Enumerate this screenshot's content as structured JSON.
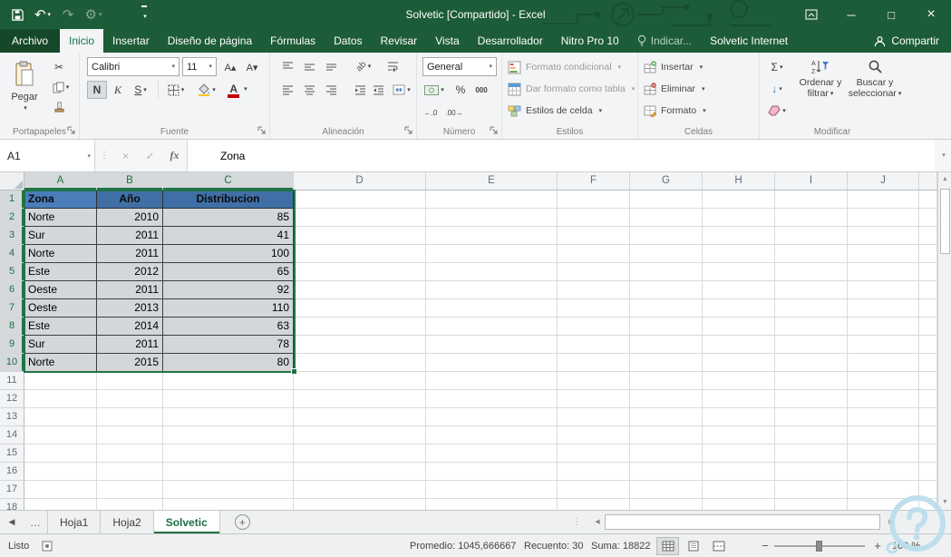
{
  "colors": {
    "accent": "#217346",
    "title_bar": "#1d5c38",
    "header_fill": "#3f6fa5",
    "active_header_fill": "#4a7dba",
    "selection_fill": "#d3d7da"
  },
  "title_bar": {
    "title": "Solvetic  [Compartido] - Excel"
  },
  "icons": {
    "undo": "↶",
    "redo": "↷",
    "gear": "⚙",
    "minimize": "─",
    "maximize": "□",
    "close": "×",
    "cut": "✂",
    "font_grow": "A▴",
    "font_shrink": "A▾",
    "bold": "N",
    "italic": "K",
    "underline": "S",
    "font_color_letter": "A",
    "fill_color_letter": "",
    "orientation": "ab",
    "percent": "%",
    "thousands": "000",
    "decimal_inc": "←.0",
    "decimal_dec": ".00→",
    "sigma": "Σ",
    "fill_down": "↓",
    "cancel": "×",
    "check": "✓",
    "fx": "fx",
    "dots": "⋮",
    "scroll_up": "▲",
    "scroll_down": "▼",
    "scroll_left": "◀",
    "scroll_right": "▶",
    "tab_nav_left": "◀",
    "tab_ellipsis": "…",
    "new_sheet": "+",
    "zoom_out": "−",
    "zoom_in": "+"
  },
  "ribbon_tabs": {
    "items": [
      {
        "label": "Archivo"
      },
      {
        "label": "Inicio",
        "selected": true
      },
      {
        "label": "Insertar"
      },
      {
        "label": "Diseño de página"
      },
      {
        "label": "Fórmulas"
      },
      {
        "label": "Datos"
      },
      {
        "label": "Revisar"
      },
      {
        "label": "Vista"
      },
      {
        "label": "Desarrollador"
      },
      {
        "label": "Nitro Pro 10"
      },
      {
        "label": "Indicar..."
      },
      {
        "label": "Solvetic Internet"
      }
    ],
    "share": "Compartir"
  },
  "ribbon": {
    "groups": {
      "clipboard": {
        "label": "Portapapeles",
        "paste": "Pegar"
      },
      "font": {
        "label": "Fuente",
        "font_name": "Calibri",
        "font_size": "11"
      },
      "alignment": {
        "label": "Alineación"
      },
      "number": {
        "label": "Número",
        "format": "General"
      },
      "styles": {
        "label": "Estilos",
        "items": [
          "Formato condicional",
          "Dar formato como tabla",
          "Estilos de celda"
        ]
      },
      "cells": {
        "label": "Celdas",
        "items": [
          "Insertar",
          "Eliminar",
          "Formato"
        ]
      },
      "editing": {
        "label": "Modificar",
        "sort_line1": "Ordenar y",
        "sort_line2": "filtrar",
        "find_line1": "Buscar y",
        "find_line2": "seleccionar"
      }
    }
  },
  "formula_bar": {
    "name_box": "A1",
    "value": "Zona"
  },
  "grid": {
    "column_headers": [
      "A",
      "B",
      "C",
      "D",
      "E",
      "F",
      "G",
      "H",
      "I",
      "J",
      ""
    ],
    "selected_columns": [
      "A",
      "B",
      "C"
    ],
    "row_count": 18,
    "selected_rows_through": 10
  },
  "table": {
    "headers": [
      "Zona",
      "Año",
      "Distribucion"
    ],
    "rows": [
      [
        "Norte",
        "2010",
        "85"
      ],
      [
        "Sur",
        "2011",
        "41"
      ],
      [
        "Norte",
        "2011",
        "100"
      ],
      [
        "Este",
        "2012",
        "65"
      ],
      [
        "Oeste",
        "2011",
        "92"
      ],
      [
        "Oeste",
        "2013",
        "110"
      ],
      [
        "Este",
        "2014",
        "63"
      ],
      [
        "Sur",
        "2011",
        "78"
      ],
      [
        "Norte",
        "2015",
        "80"
      ]
    ]
  },
  "sheet_bar": {
    "tabs": [
      {
        "label": "Hoja1",
        "active": false
      },
      {
        "label": "Hoja2",
        "active": false
      },
      {
        "label": "Solvetic",
        "active": true
      }
    ]
  },
  "status_bar": {
    "mode": "Listo",
    "average": "Promedio: 1045,666667",
    "count": "Recuento: 30",
    "sum": "Suma: 18822",
    "zoom": "100 %"
  }
}
